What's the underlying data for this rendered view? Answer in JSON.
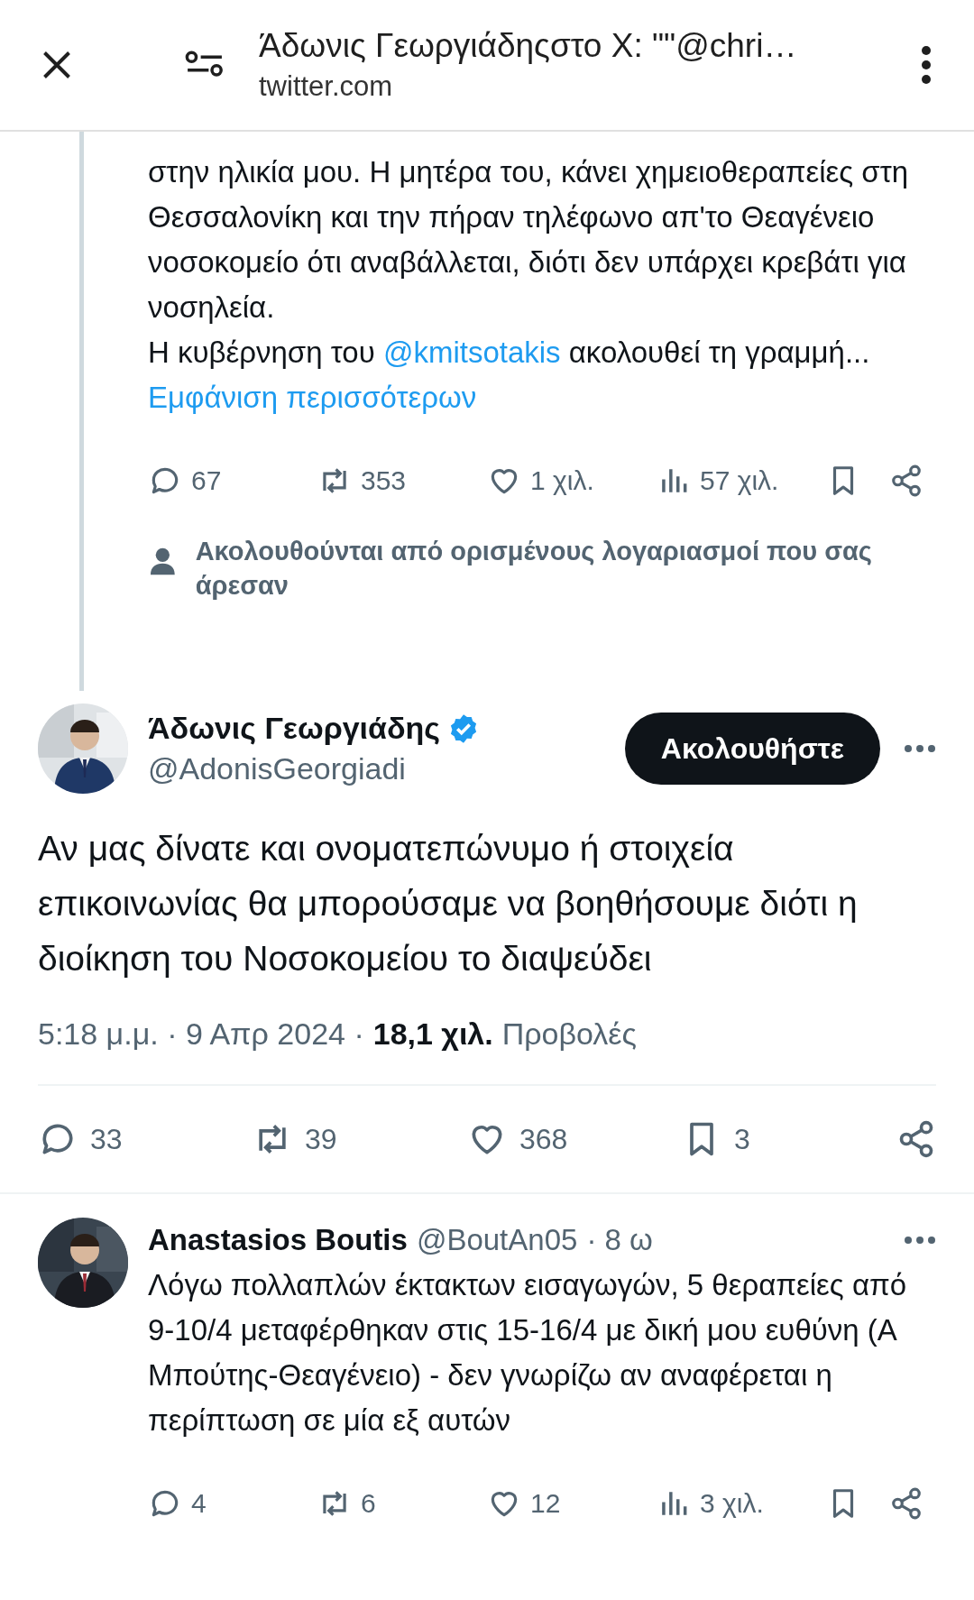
{
  "header": {
    "title": "Άδωνις Γεωργιάδηςστο X: \"\"@chri…",
    "url": "twitter.com"
  },
  "thread_tweet": {
    "paragraphs": [
      [
        {
          "text": "στην ηλικία μου. Η μητέρα του, κάνει χημειοθεραπείες στη Θεσσαλονίκη και την πήραν τηλέφωνο απ'το Θεαγένειο νοσοκομείο ότι αναβάλλεται, διότι δεν υπάρχει κρεβάτι για νοσηλεία."
        }
      ],
      [
        {
          "text": "Η κυβέρνηση του "
        },
        {
          "text": "@kmitsotakis",
          "kind": "mention"
        },
        {
          "text": " ακολουθεί τη γραμμή..."
        }
      ]
    ],
    "show_more": "Εμφάνιση περισσότερων",
    "actions": [
      {
        "kind": "reply",
        "count": "67"
      },
      {
        "kind": "retweet",
        "count": "353"
      },
      {
        "kind": "like",
        "count": "1 χιλ."
      },
      {
        "kind": "views",
        "count": "57 χιλ."
      },
      {
        "kind": "bookmark"
      },
      {
        "kind": "share"
      }
    ]
  },
  "main_tweet": {
    "social_context": "Ακολουθούνται από ορισμένους λογαριασμοί που σας άρεσαν",
    "author": {
      "name": "Άδωνις Γεωργιάδης",
      "verified": true,
      "handle": "@AdonisGeorgiadi"
    },
    "follow_button": "Ακολουθήστε",
    "text": "Αν μας δίνατε και ονοματεπώνυμο ή στοιχεία επικοινωνίας θα μπορούσαμε να βοηθήσουμε διότι η διοίκηση του Νοσοκομείου το διαψεύδει",
    "timestamp": "5:18 μ.μ. · 9 Απρ 2024 ·",
    "views_count": "18,1 χιλ.",
    "views_label": "Προβολές",
    "actions": [
      {
        "kind": "reply",
        "count": "33"
      },
      {
        "kind": "retweet",
        "count": "39"
      },
      {
        "kind": "like",
        "count": "368"
      },
      {
        "kind": "bookmark",
        "count": "3"
      },
      {
        "kind": "share"
      }
    ]
  },
  "reply": {
    "author": {
      "name": "Anastasios Boutis",
      "handle": "@BoutAn05",
      "age": "· 8 ω"
    },
    "text": "Λόγω πολλαπλών έκτακτων εισαγωγών, 5 θεραπείες από 9-10/4 μεταφέρθηκαν στις 15-16/4 με δική μου ευθύνη (Α Μπούτης-Θεαγένειο) - δεν γνωρίζω αν αναφέρεται η περίπτωση σε μία εξ αυτών",
    "actions": [
      {
        "kind": "reply",
        "count": "4"
      },
      {
        "kind": "retweet",
        "count": "6"
      },
      {
        "kind": "like",
        "count": "12"
      },
      {
        "kind": "views",
        "count": "3 χιλ."
      },
      {
        "kind": "bookmark"
      },
      {
        "kind": "share"
      }
    ]
  }
}
